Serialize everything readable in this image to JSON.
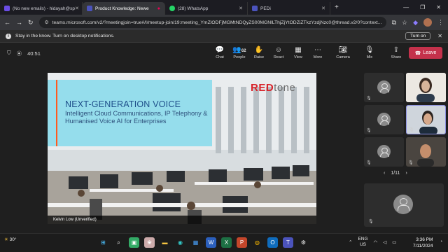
{
  "browser": {
    "tabs": [
      {
        "label": "(No new emails) - hidayah@sp",
        "color": "#6b4de6"
      },
      {
        "label": "Product Knowledge: Newe",
        "color": "#4b53bc"
      },
      {
        "label": "(28) WhatsApp",
        "color": "#25d366"
      },
      {
        "label": "PEDi",
        "color": "#4b53bc"
      }
    ],
    "url": "teams.microsoft.com/v2/?meetingjoin=true#/l/meetup-join/19:meeting_YmZlODFjMGMtNDQyZS00MGNlLThjZjYtODZiZTkzYzdjNzc0@thread.v2/0?context..."
  },
  "notification": {
    "text": "Stay in the know. Turn on desktop notifications.",
    "button": "Turn on"
  },
  "meeting": {
    "timer": "40:51",
    "controls": [
      {
        "label": "Chat",
        "icon": "chat-icon",
        "glyph": "💬"
      },
      {
        "label": "People",
        "icon": "people-icon",
        "glyph": "👥",
        "count": "62"
      },
      {
        "label": "Raise",
        "icon": "raise-hand-icon",
        "glyph": "✋"
      },
      {
        "label": "React",
        "icon": "react-icon",
        "glyph": "☺"
      },
      {
        "label": "View",
        "icon": "view-icon",
        "glyph": "▦"
      },
      {
        "label": "More",
        "icon": "more-icon",
        "glyph": "⋯"
      }
    ],
    "camera_label": "Camera",
    "mic_label": "Mic",
    "share_label": "Share",
    "leave_label": "Leave",
    "leave_color": "#c4314b"
  },
  "slide": {
    "headline": "NEXT-GENERATION VOICE",
    "subtitle": "Intelligent Cloud Communications, IP Telephony & Humanised Voice AI for Enterprises",
    "brand_red": "RED",
    "brand_gray": "tone",
    "presenter": "Kelvin Low (Unverified)"
  },
  "gallery": {
    "page_indicator": "1/11"
  },
  "taskbar": {
    "temperature": "30°",
    "lang_top": "ENG",
    "lang_bottom": "US",
    "time": "3:36 PM",
    "date": "7/11/2024"
  }
}
